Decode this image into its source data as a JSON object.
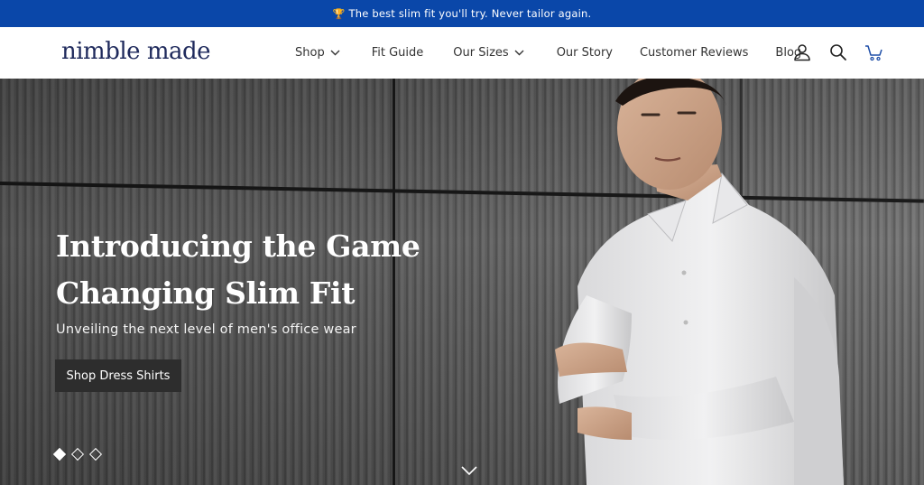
{
  "announcement": {
    "icon": "trophy-icon",
    "text": "The best slim fit you'll try. Never tailor again."
  },
  "header": {
    "logo": "nimble made",
    "nav": [
      {
        "label": "Shop",
        "has_dropdown": true
      },
      {
        "label": "Fit Guide",
        "has_dropdown": false
      },
      {
        "label": "Our Sizes",
        "has_dropdown": true
      },
      {
        "label": "Our Story",
        "has_dropdown": false
      },
      {
        "label": "Customer Reviews",
        "has_dropdown": false
      },
      {
        "label": "Blog",
        "has_dropdown": false
      }
    ],
    "icons": [
      "account-icon",
      "search-icon",
      "cart-icon"
    ]
  },
  "hero": {
    "headline_line1": "Introducing the Game",
    "headline_line2": "Changing Slim Fit",
    "subheadline": "Unveiling the next level of men's office wear",
    "cta_label": "Shop Dress Shirts",
    "slides_total": 3,
    "active_slide": 1
  },
  "colors": {
    "announcement_bg": "#0a47a9",
    "logo": "#1f2a5c",
    "cta_bg": "#2d2d2d"
  }
}
